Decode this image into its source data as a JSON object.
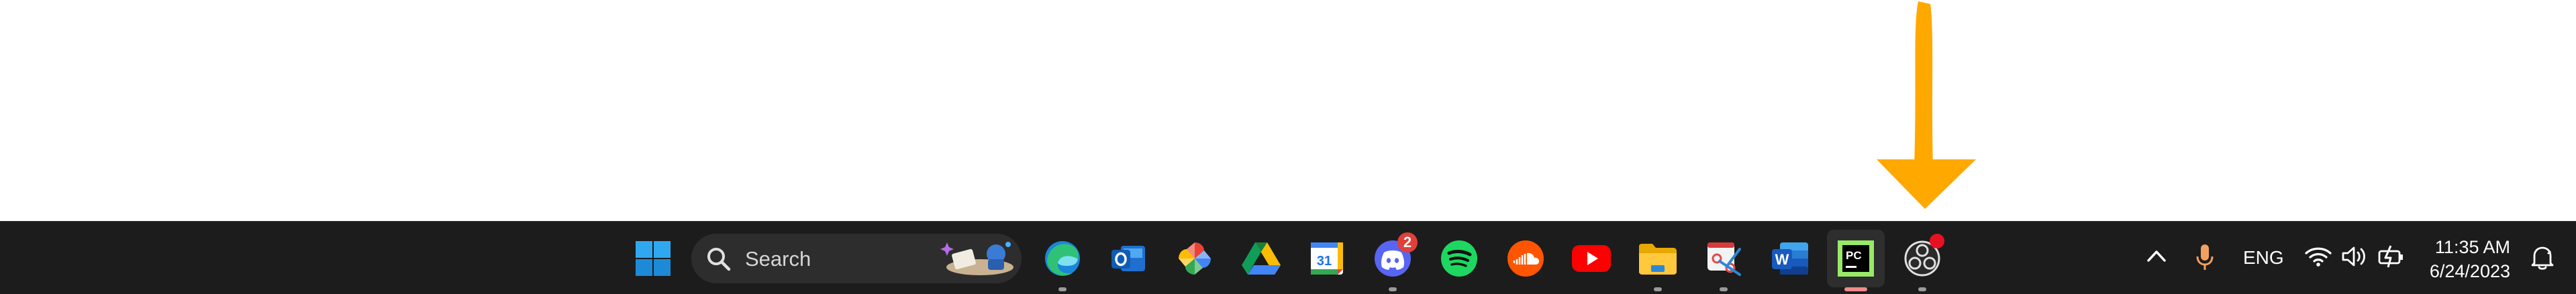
{
  "taskbar": {
    "search": {
      "placeholder": "Search"
    },
    "apps": [
      {
        "name": "Start",
        "icon": "windows-logo-icon"
      },
      {
        "name": "Microsoft Edge",
        "icon": "edge-icon"
      },
      {
        "name": "Outlook",
        "icon": "outlook-icon"
      },
      {
        "name": "Photos",
        "icon": "photos-pinwheel-icon"
      },
      {
        "name": "Google Drive",
        "icon": "google-drive-icon"
      },
      {
        "name": "Google Calendar",
        "icon": "calendar-icon",
        "label": "31"
      },
      {
        "name": "Discord",
        "icon": "discord-icon",
        "badge": "2"
      },
      {
        "name": "Spotify",
        "icon": "spotify-icon"
      },
      {
        "name": "SoundCloud",
        "icon": "soundcloud-icon"
      },
      {
        "name": "YouTube",
        "icon": "youtube-icon"
      },
      {
        "name": "File Explorer",
        "icon": "folder-icon"
      },
      {
        "name": "Snipping Tool",
        "icon": "snipping-tool-icon"
      },
      {
        "name": "Word",
        "icon": "word-icon",
        "label": "W"
      },
      {
        "name": "PyCharm",
        "icon": "pycharm-icon",
        "label": "PC"
      },
      {
        "name": "OBS Studio",
        "icon": "obs-icon"
      }
    ],
    "tray": {
      "language": "ENG",
      "time": "11:35 AM",
      "date": "6/24/2023",
      "icons": [
        "chevron-up-icon",
        "microphone-icon",
        "wifi-icon",
        "volume-icon",
        "battery-charging-icon",
        "notification-bell-icon"
      ]
    }
  },
  "annotation": {
    "icon": "down-arrow-icon",
    "color": "#ffa800"
  },
  "colors": {
    "taskbar": "#1c1c1c",
    "accent_running": "#f08a8a",
    "badge": "#e0403a"
  }
}
